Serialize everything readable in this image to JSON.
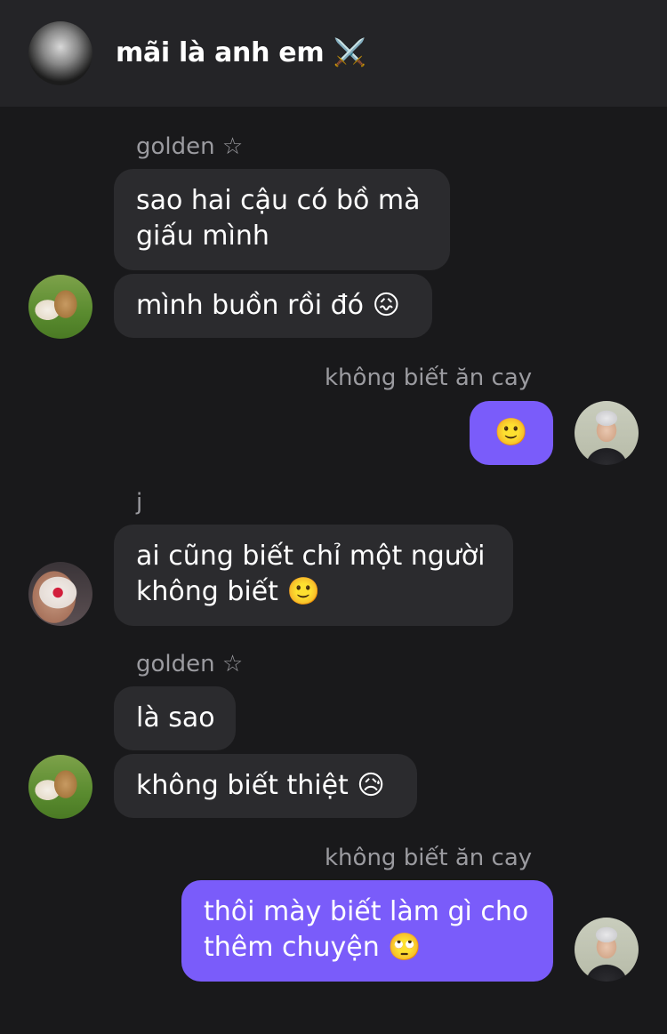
{
  "header": {
    "title": "mãi là anh em ⚔️",
    "avatar_icon": "group-avatar"
  },
  "messages": [
    {
      "sender": "golden ☆",
      "bubbles": [
        "sao hai cậu có bồ mà",
        "giấu mình",
        "mình buồn rồi đó 😖"
      ]
    },
    {
      "sender": "không biết ăn cay",
      "bubbles": [
        "🙂"
      ]
    },
    {
      "sender": "j",
      "bubbles": [
        "ai cũng biết chỉ một người",
        "không biết 🙂"
      ]
    },
    {
      "sender": "golden ☆",
      "bubbles": [
        "là sao",
        "không biết thiệt 😥"
      ]
    },
    {
      "sender": "không biết ăn cay",
      "bubbles": [
        "thôi mày biết làm gì cho",
        "thêm chuyện 🙄"
      ]
    }
  ],
  "colors": {
    "background": "#19191b",
    "header": "#242427",
    "incoming_bubble": "#2b2b2e",
    "outgoing_bubble": "#7a5cfa",
    "sender_name": "#9b9ba0"
  }
}
